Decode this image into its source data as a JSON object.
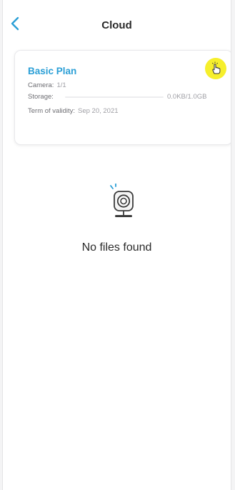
{
  "header": {
    "title": "Cloud",
    "back_icon": "chevron-left-icon"
  },
  "plan": {
    "name": "Basic Plan",
    "action_icon": "tap-hand-icon",
    "camera_label": "Camera:",
    "camera_value": "1/1",
    "storage_label": "Storage:",
    "storage_value": "0.0KB/1.0GB",
    "storage_used_fraction": 0,
    "term_label": "Term of validity:",
    "term_value": "Sep 20, 2021"
  },
  "empty_state": {
    "icon": "camera-icon",
    "message": "No files found"
  },
  "colors": {
    "accent": "#2b9fd6",
    "highlight": "#f6ef2c",
    "text": "#2b2b2b",
    "muted": "#a0a0a6"
  }
}
